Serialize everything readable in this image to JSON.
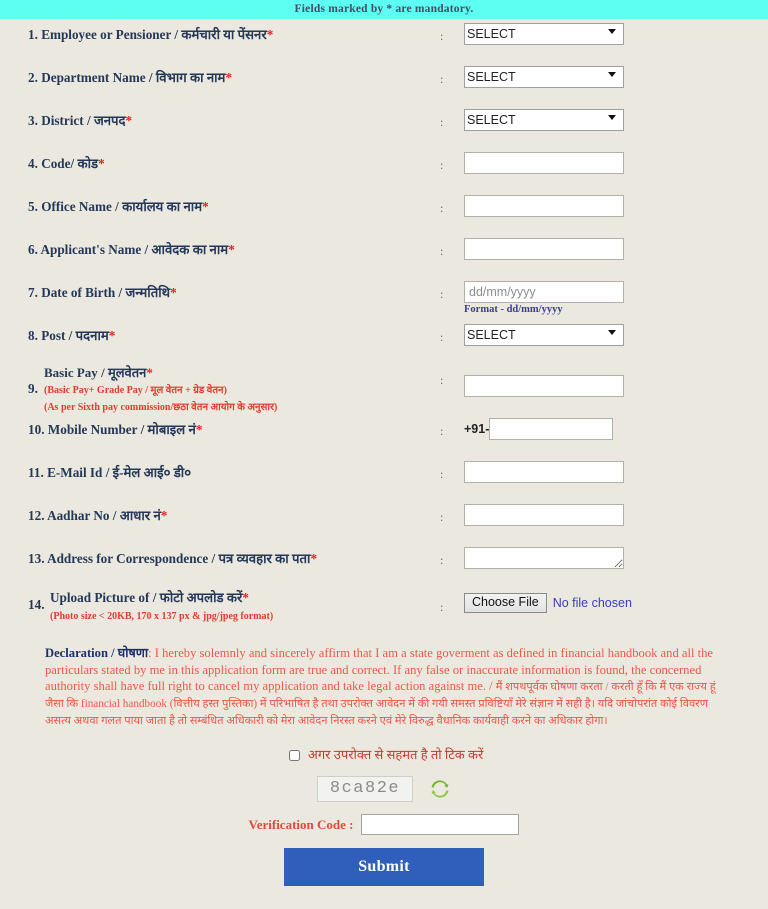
{
  "banner": {
    "text": "Fields marked by * are  mandatory."
  },
  "colon": ":",
  "select_placeholder": "SELECT",
  "fields": [
    {
      "num": "1.",
      "en": "Employee or Pensioner",
      "hi": "कर्मचारी या पेंसनर",
      "required": true,
      "type": "select",
      "value": "SELECT"
    },
    {
      "num": "2.",
      "en": "Department Name",
      "hi": "विभाग का नाम",
      "required": true,
      "type": "select",
      "value": "SELECT"
    },
    {
      "num": "3.",
      "en": "District",
      "hi": "जनपद",
      "required": true,
      "type": "select",
      "value": "SELECT"
    },
    {
      "num": "4.",
      "en": "Code/",
      "hi": "कोड",
      "required": true,
      "type": "text",
      "value": ""
    },
    {
      "num": "5.",
      "en": "Office Name",
      "hi": "कार्यालय का नाम",
      "required": true,
      "type": "text",
      "value": ""
    },
    {
      "num": "6.",
      "en": "Applicant's Name",
      "hi": "आवेदक का नाम",
      "required": true,
      "type": "text",
      "value": ""
    },
    {
      "num": "7.",
      "en": "Date of Birth",
      "hi": "जन्मतिथि",
      "required": true,
      "type": "date",
      "value": "",
      "placeholder": "dd/mm/yyyy",
      "hint": "Format - dd/mm/yyyy"
    },
    {
      "num": "8.",
      "en": "Post",
      "hi": "पदनाम",
      "required": true,
      "type": "select",
      "value": "SELECT"
    },
    {
      "num": "9.",
      "en": "Basic Pay",
      "hi": "मूलवेतन",
      "required": true,
      "type": "text",
      "value": "",
      "note1": "(Basic Pay+ Grade Pay / मूल वेतन + ग्रेड वेतन)",
      "note2": "(As per Sixth pay commission/छठा वेतन आयोग के अनुसार)"
    },
    {
      "num": "10.",
      "en": "Mobile Number",
      "hi": "मोबाइल नं",
      "required": true,
      "type": "mobile",
      "prefix": "+91-",
      "value": ""
    },
    {
      "num": "11.",
      "en": "E-Mail Id",
      "hi": "ई-मेल आई० डी०",
      "required": false,
      "type": "text",
      "value": ""
    },
    {
      "num": "12.",
      "en": "Aadhar No",
      "hi": "आधार नं",
      "required": true,
      "type": "text",
      "value": ""
    },
    {
      "num": "13.",
      "en": "Address for Correspondence",
      "hi": "पत्र व्यवहार का पता",
      "required": true,
      "type": "textarea",
      "value": ""
    },
    {
      "num": "14.",
      "en": "Upload Picture of ",
      "hi": "फोटो अपलोड करें",
      "required": true,
      "type": "file",
      "note1": "(Photo size < 20KB, 170 x 137 px & jpg/jpeg format)",
      "button_label": "Choose File",
      "file_status": "No file chosen"
    }
  ],
  "declaration": {
    "title": "Declaration",
    "title_hi": "घोषणा",
    "separator": " / ",
    "colon": ": ",
    "english": "I hereby solemnly and sincerely affirm that I am a state goverment  as defined in financial handbook and all the particulars stated by me in this application form are true and correct. If any  false or inaccurate information is found, the concerned authority shall have full right to cancel my application and take legal action against me. / ",
    "hindi_part1": "मैं शपथपूर्वक घोषणा करता / करती हूँ कि मैं एक राज्य  हूं जैसा कि ",
    "hindi_inline_en": "financial handbook",
    "hindi_part2": " (वित्तीय हस्त पुस्तिका) में परिभाषित है तथा उपरोक्त आवेदन में की गयी समस्त प्रविष्टियाँ मेरे संज्ञान में सही है। यदि जांचोपरांत कोई विवरण असत्य अथवा गलत पाया जाता है तो सम्बंधित अधिकारी को मेरा आवेदन निरस्त करने एवं मेरे विरुद्ध वैधानिक कार्यवाही करने का अधिकार होगा।"
  },
  "agree": {
    "label": "अगर उपरोक्त से सहमत है तो टिक करें",
    "checked": false
  },
  "captcha": {
    "code": "8ca82e",
    "refresh_icon": "refresh-icon"
  },
  "verification": {
    "label": "Verification Code :",
    "value": ""
  },
  "submit": {
    "label": "Submit"
  },
  "colors": {
    "banner_bg": "#5dfff3",
    "page_bg": "#ebe9df",
    "label": "#253858",
    "required_star": "#e02020",
    "declaration": "#f0564a",
    "submit_bg": "#2f5fba",
    "hint": "#3b3b9e",
    "refresh": "#5cb32b"
  }
}
